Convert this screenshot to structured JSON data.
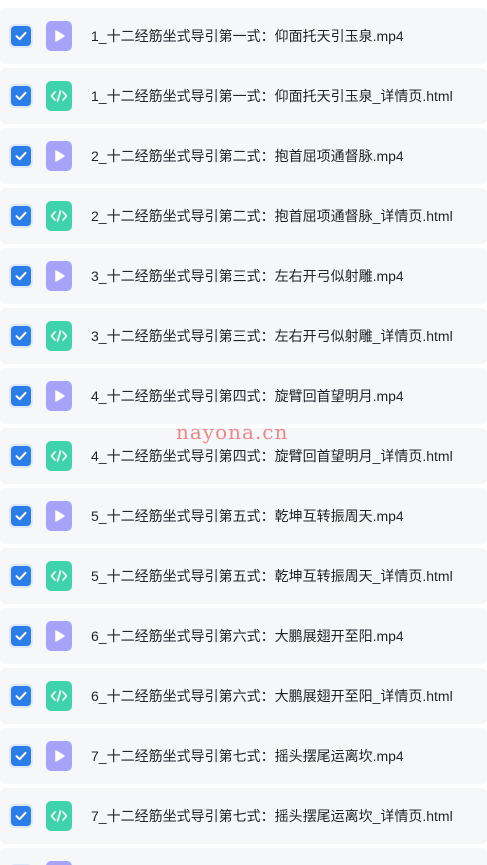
{
  "files": [
    {
      "name": "1_十二经筋坐式导引第一式：仰面托天引玉泉.mp4",
      "type": "video",
      "checked": true
    },
    {
      "name": "1_十二经筋坐式导引第一式：仰面托天引玉泉_详情页.html",
      "type": "html",
      "checked": true
    },
    {
      "name": "2_十二经筋坐式导引第二式：抱首屈项通督脉.mp4",
      "type": "video",
      "checked": true
    },
    {
      "name": "2_十二经筋坐式导引第二式：抱首屈项通督脉_详情页.html",
      "type": "html",
      "checked": true
    },
    {
      "name": "3_十二经筋坐式导引第三式：左右开弓似射雕.mp4",
      "type": "video",
      "checked": true
    },
    {
      "name": "3_十二经筋坐式导引第三式：左右开弓似射雕_详情页.html",
      "type": "html",
      "checked": true
    },
    {
      "name": "4_十二经筋坐式导引第四式：旋臂回首望明月.mp4",
      "type": "video",
      "checked": true
    },
    {
      "name": "4_十二经筋坐式导引第四式：旋臂回首望明月_详情页.html",
      "type": "html",
      "checked": true
    },
    {
      "name": "5_十二经筋坐式导引第五式：乾坤互转振周天.mp4",
      "type": "video",
      "checked": true
    },
    {
      "name": "5_十二经筋坐式导引第五式：乾坤互转振周天_详情页.html",
      "type": "html",
      "checked": true
    },
    {
      "name": "6_十二经筋坐式导引第六式：大鹏展翅开至阳.mp4",
      "type": "video",
      "checked": true
    },
    {
      "name": "6_十二经筋坐式导引第六式：大鹏展翅开至阳_详情页.html",
      "type": "html",
      "checked": true
    },
    {
      "name": "7_十二经筋坐式导引第七式：摇头摆尾运离坎.mp4",
      "type": "video",
      "checked": true
    },
    {
      "name": "7_十二经筋坐式导引第七式：摇头摆尾运离坎_详情页.html",
      "type": "html",
      "checked": true
    },
    {
      "name": "",
      "type": "video",
      "checked": true
    }
  ],
  "watermark": "nayona.cn",
  "colors": {
    "checkbox": "#2b7de9",
    "video_icon": "#a7a3f8",
    "html_icon": "#3ed3ad",
    "row_bg": "#f6f7f9"
  }
}
